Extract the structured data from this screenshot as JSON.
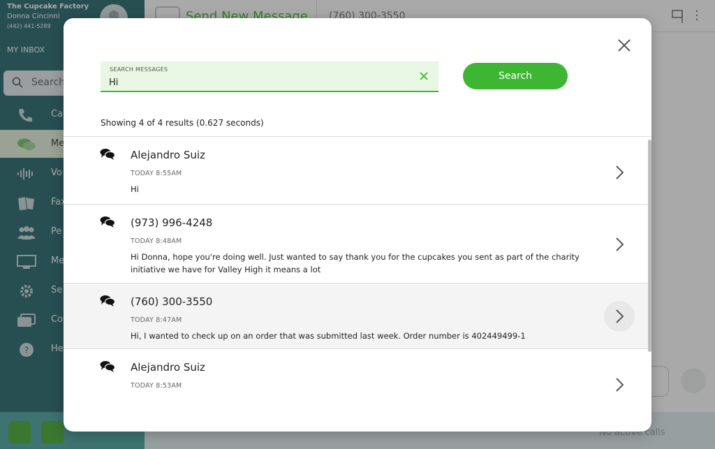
{
  "account": {
    "company": "The Cupcake Factory",
    "user": "Donna Cincinni",
    "phone": "(442) 441-5289"
  },
  "sidebar": {
    "inbox_label": "MY INBOX",
    "search_placeholder": "Search",
    "items": [
      {
        "label": "Calls",
        "icon": "phone-icon"
      },
      {
        "label": "Messages",
        "icon": "chat-bubbles-icon"
      },
      {
        "label": "Voicemail",
        "icon": "voicemail-icon"
      },
      {
        "label": "Fax",
        "icon": "fax-icon"
      },
      {
        "label": "People",
        "icon": "people-icon"
      },
      {
        "label": "Meetings",
        "icon": "meeting-icon"
      },
      {
        "label": "Settings",
        "icon": "gear-icon"
      },
      {
        "label": "Contacts",
        "icon": "contacts-icon"
      },
      {
        "label": "Help",
        "icon": "help-icon"
      }
    ],
    "visible_labels": [
      "Ca",
      "Me",
      "Vo",
      "Fax",
      "Pe",
      "Me",
      "Se",
      "Co",
      "He"
    ]
  },
  "header": {
    "send_new_label": "Send New Message",
    "conversation_phone": "(760) 300-3550"
  },
  "footer": {
    "status": "No active calls"
  },
  "modal": {
    "search_label": "SEARCH MESSAGES",
    "search_value": "Hi",
    "search_button": "Search",
    "results_summary": "Showing 4 of 4 results (0.627 seconds)",
    "results": [
      {
        "name": "Alejandro Suiz",
        "time": "TODAY 8:55AM",
        "body": "Hi"
      },
      {
        "name": "(973) 996-4248",
        "time": "TODAY 8:48AM",
        "body": "Hi Donna, hope you're doing well. Just wanted to say thank you for the cupcakes you sent as part of the charity initiative we have for Valley High it means a lot"
      },
      {
        "name": "(760) 300-3550",
        "time": "TODAY 8:47AM",
        "body": "Hi, I wanted to check up on an order that was submitted last week. Order number is 402449499-1"
      },
      {
        "name": "Alejandro Suiz",
        "time": "TODAY 8:53AM",
        "body": ""
      }
    ]
  },
  "colors": {
    "accent": "#3fb534",
    "sidebar": "#2e6f73",
    "search_field_bg": "#e8f7e3",
    "selected_row": "#f4f4f4"
  }
}
